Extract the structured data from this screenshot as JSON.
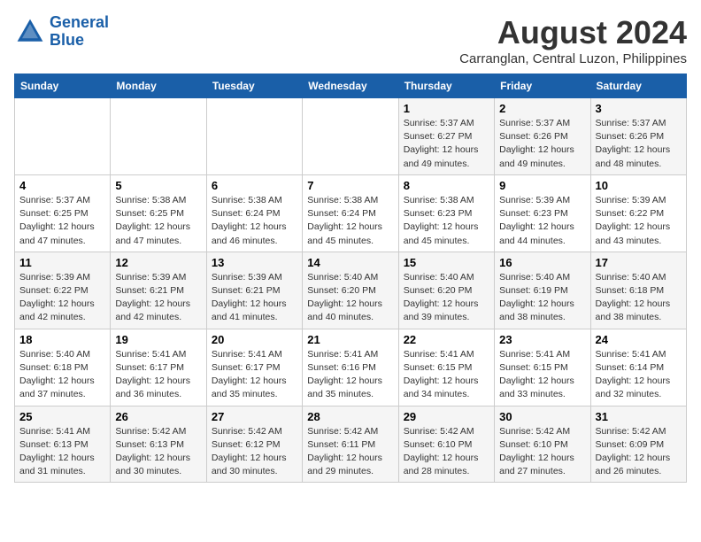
{
  "header": {
    "logo_general": "General",
    "logo_blue": "Blue",
    "month_year": "August 2024",
    "location": "Carranglan, Central Luzon, Philippines"
  },
  "weekdays": [
    "Sunday",
    "Monday",
    "Tuesday",
    "Wednesday",
    "Thursday",
    "Friday",
    "Saturday"
  ],
  "weeks": [
    [
      {
        "day": "",
        "sunrise": "",
        "sunset": "",
        "daylight": ""
      },
      {
        "day": "",
        "sunrise": "",
        "sunset": "",
        "daylight": ""
      },
      {
        "day": "",
        "sunrise": "",
        "sunset": "",
        "daylight": ""
      },
      {
        "day": "",
        "sunrise": "",
        "sunset": "",
        "daylight": ""
      },
      {
        "day": "1",
        "sunrise": "5:37 AM",
        "sunset": "6:27 PM",
        "daylight": "12 hours and 49 minutes."
      },
      {
        "day": "2",
        "sunrise": "5:37 AM",
        "sunset": "6:26 PM",
        "daylight": "12 hours and 49 minutes."
      },
      {
        "day": "3",
        "sunrise": "5:37 AM",
        "sunset": "6:26 PM",
        "daylight": "12 hours and 48 minutes."
      }
    ],
    [
      {
        "day": "4",
        "sunrise": "5:37 AM",
        "sunset": "6:25 PM",
        "daylight": "12 hours and 47 minutes."
      },
      {
        "day": "5",
        "sunrise": "5:38 AM",
        "sunset": "6:25 PM",
        "daylight": "12 hours and 47 minutes."
      },
      {
        "day": "6",
        "sunrise": "5:38 AM",
        "sunset": "6:24 PM",
        "daylight": "12 hours and 46 minutes."
      },
      {
        "day": "7",
        "sunrise": "5:38 AM",
        "sunset": "6:24 PM",
        "daylight": "12 hours and 45 minutes."
      },
      {
        "day": "8",
        "sunrise": "5:38 AM",
        "sunset": "6:23 PM",
        "daylight": "12 hours and 45 minutes."
      },
      {
        "day": "9",
        "sunrise": "5:39 AM",
        "sunset": "6:23 PM",
        "daylight": "12 hours and 44 minutes."
      },
      {
        "day": "10",
        "sunrise": "5:39 AM",
        "sunset": "6:22 PM",
        "daylight": "12 hours and 43 minutes."
      }
    ],
    [
      {
        "day": "11",
        "sunrise": "5:39 AM",
        "sunset": "6:22 PM",
        "daylight": "12 hours and 42 minutes."
      },
      {
        "day": "12",
        "sunrise": "5:39 AM",
        "sunset": "6:21 PM",
        "daylight": "12 hours and 42 minutes."
      },
      {
        "day": "13",
        "sunrise": "5:39 AM",
        "sunset": "6:21 PM",
        "daylight": "12 hours and 41 minutes."
      },
      {
        "day": "14",
        "sunrise": "5:40 AM",
        "sunset": "6:20 PM",
        "daylight": "12 hours and 40 minutes."
      },
      {
        "day": "15",
        "sunrise": "5:40 AM",
        "sunset": "6:20 PM",
        "daylight": "12 hours and 39 minutes."
      },
      {
        "day": "16",
        "sunrise": "5:40 AM",
        "sunset": "6:19 PM",
        "daylight": "12 hours and 38 minutes."
      },
      {
        "day": "17",
        "sunrise": "5:40 AM",
        "sunset": "6:18 PM",
        "daylight": "12 hours and 38 minutes."
      }
    ],
    [
      {
        "day": "18",
        "sunrise": "5:40 AM",
        "sunset": "6:18 PM",
        "daylight": "12 hours and 37 minutes."
      },
      {
        "day": "19",
        "sunrise": "5:41 AM",
        "sunset": "6:17 PM",
        "daylight": "12 hours and 36 minutes."
      },
      {
        "day": "20",
        "sunrise": "5:41 AM",
        "sunset": "6:17 PM",
        "daylight": "12 hours and 35 minutes."
      },
      {
        "day": "21",
        "sunrise": "5:41 AM",
        "sunset": "6:16 PM",
        "daylight": "12 hours and 35 minutes."
      },
      {
        "day": "22",
        "sunrise": "5:41 AM",
        "sunset": "6:15 PM",
        "daylight": "12 hours and 34 minutes."
      },
      {
        "day": "23",
        "sunrise": "5:41 AM",
        "sunset": "6:15 PM",
        "daylight": "12 hours and 33 minutes."
      },
      {
        "day": "24",
        "sunrise": "5:41 AM",
        "sunset": "6:14 PM",
        "daylight": "12 hours and 32 minutes."
      }
    ],
    [
      {
        "day": "25",
        "sunrise": "5:41 AM",
        "sunset": "6:13 PM",
        "daylight": "12 hours and 31 minutes."
      },
      {
        "day": "26",
        "sunrise": "5:42 AM",
        "sunset": "6:13 PM",
        "daylight": "12 hours and 30 minutes."
      },
      {
        "day": "27",
        "sunrise": "5:42 AM",
        "sunset": "6:12 PM",
        "daylight": "12 hours and 30 minutes."
      },
      {
        "day": "28",
        "sunrise": "5:42 AM",
        "sunset": "6:11 PM",
        "daylight": "12 hours and 29 minutes."
      },
      {
        "day": "29",
        "sunrise": "5:42 AM",
        "sunset": "6:10 PM",
        "daylight": "12 hours and 28 minutes."
      },
      {
        "day": "30",
        "sunrise": "5:42 AM",
        "sunset": "6:10 PM",
        "daylight": "12 hours and 27 minutes."
      },
      {
        "day": "31",
        "sunrise": "5:42 AM",
        "sunset": "6:09 PM",
        "daylight": "12 hours and 26 minutes."
      }
    ]
  ]
}
